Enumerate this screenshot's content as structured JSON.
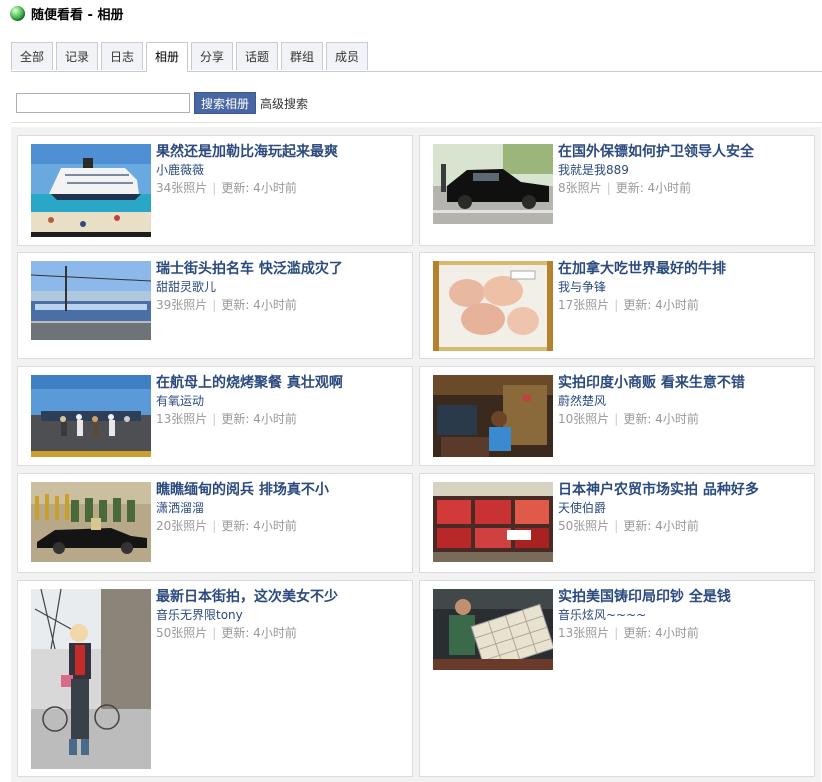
{
  "page": {
    "title": "随便看看 - 相册"
  },
  "tabs": [
    {
      "label": "全部",
      "active": false
    },
    {
      "label": "记录",
      "active": false
    },
    {
      "label": "日志",
      "active": false
    },
    {
      "label": "相册",
      "active": true
    },
    {
      "label": "分享",
      "active": false
    },
    {
      "label": "话题",
      "active": false
    },
    {
      "label": "群组",
      "active": false
    },
    {
      "label": "成员",
      "active": false
    }
  ],
  "search": {
    "value": "",
    "button": "搜索相册",
    "advanced": "高级搜索"
  },
  "meta_separator": "|",
  "albums": [
    {
      "title": "果然还是加勒比海玩起来最爽",
      "author": "小鹿薇薇",
      "photos": "34张照片",
      "updated": "更新: 4小时前",
      "image": "cruise-ship-photo"
    },
    {
      "title": "在国外保镖如何护卫领导人安全",
      "author": "我就是我889",
      "photos": "8张照片",
      "updated": "更新: 4小时前",
      "image": "black-car-photo"
    },
    {
      "title": "瑞士街头拍名车 快泛滥成灾了",
      "author": "甜甜灵歌儿",
      "photos": "39张照片",
      "updated": "更新: 4小时前",
      "image": "tram-street-photo"
    },
    {
      "title": "在加拿大吃世界最好的牛排",
      "author": "我与争锋",
      "photos": "17张照片",
      "updated": "更新: 4小时前",
      "image": "steak-package-photo"
    },
    {
      "title": "在航母上的烧烤聚餐 真壮观啊",
      "author": "有氧运动",
      "photos": "13张照片",
      "updated": "更新: 4小时前",
      "image": "carrier-deck-photo"
    },
    {
      "title": "实拍印度小商贩 看来生意不错",
      "author": "蔚然楚风",
      "photos": "10张照片",
      "updated": "更新: 4小时前",
      "image": "vendor-photo"
    },
    {
      "title": "瞧瞧缅甸的阅兵 排场真不小",
      "author": "潇洒溜溜",
      "photos": "20张照片",
      "updated": "更新: 4小时前",
      "image": "parade-photo"
    },
    {
      "title": "日本神户农贸市场实拍 品种好多",
      "author": "天使伯爵",
      "photos": "50张照片",
      "updated": "更新: 4小时前",
      "image": "meat-market-photo"
    },
    {
      "title": "最新日本街拍，这次美女不少",
      "author": "音乐无界限tony",
      "photos": "50张照片",
      "updated": "更新: 4小时前",
      "image": "street-fashion-photo"
    },
    {
      "title": "实拍美国铸印局印钞 全是钱",
      "author": "音乐炫风~~~~",
      "photos": "13张照片",
      "updated": "更新: 4小时前",
      "image": "money-printing-photo"
    }
  ]
}
